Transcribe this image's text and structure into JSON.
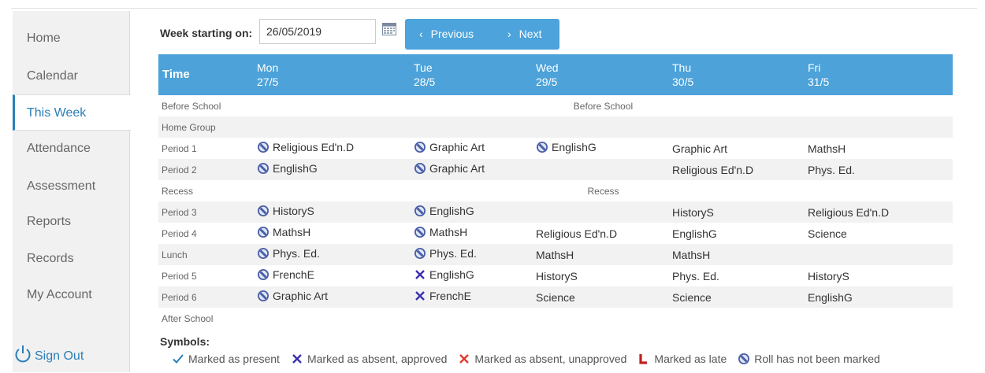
{
  "sidebar": {
    "items": [
      {
        "label": "Home",
        "active": false
      },
      {
        "label": "Calendar",
        "active": false
      },
      {
        "label": "This Week",
        "active": true
      },
      {
        "label": "Attendance",
        "active": false
      },
      {
        "label": "Assessment",
        "active": false
      },
      {
        "label": "Reports",
        "active": false
      },
      {
        "label": "Records",
        "active": false
      },
      {
        "label": "My Account",
        "active": false
      }
    ],
    "sign_out": "Sign Out"
  },
  "toolbar": {
    "week_label": "Week starting on:",
    "week_value": "26/05/2019",
    "previous_label": "Previous",
    "next_label": "Next"
  },
  "timetable": {
    "time_header": "Time",
    "days": [
      {
        "name": "Mon",
        "date": "27/5"
      },
      {
        "name": "Tue",
        "date": "28/5"
      },
      {
        "name": "Wed",
        "date": "29/5"
      },
      {
        "name": "Thu",
        "date": "30/5"
      },
      {
        "name": "Fri",
        "date": "31/5"
      }
    ],
    "rows": [
      {
        "period": "Before School",
        "span": "Before School"
      },
      {
        "period": "Home Group",
        "span": ""
      },
      {
        "period": "Period 1",
        "cells": [
          {
            "text": "Religious Ed'n.D",
            "sym": "roll-not-marked"
          },
          {
            "text": "Graphic Art",
            "sym": "roll-not-marked"
          },
          {
            "text": "EnglishG",
            "sym": "roll-not-marked"
          },
          {
            "text": "Graphic Art",
            "sym": ""
          },
          {
            "text": "MathsH",
            "sym": ""
          }
        ]
      },
      {
        "period": "Period 2",
        "cells": [
          {
            "text": "EnglishG",
            "sym": "roll-not-marked"
          },
          {
            "text": "Graphic Art",
            "sym": "roll-not-marked"
          },
          {
            "text": "",
            "sym": ""
          },
          {
            "text": "Religious Ed'n.D",
            "sym": ""
          },
          {
            "text": "Phys. Ed.",
            "sym": ""
          }
        ]
      },
      {
        "period": "Recess",
        "span": "Recess"
      },
      {
        "period": "Period 3",
        "cells": [
          {
            "text": "HistoryS",
            "sym": "roll-not-marked"
          },
          {
            "text": "EnglishG",
            "sym": "roll-not-marked"
          },
          {
            "text": "",
            "sym": ""
          },
          {
            "text": "HistoryS",
            "sym": ""
          },
          {
            "text": "Religious Ed'n.D",
            "sym": ""
          }
        ]
      },
      {
        "period": "Period 4",
        "cells": [
          {
            "text": "MathsH",
            "sym": "roll-not-marked"
          },
          {
            "text": "MathsH",
            "sym": "roll-not-marked"
          },
          {
            "text": "Religious Ed'n.D",
            "sym": ""
          },
          {
            "text": "EnglishG",
            "sym": ""
          },
          {
            "text": "Science",
            "sym": ""
          }
        ]
      },
      {
        "period": "Lunch",
        "cells": [
          {
            "text": "Phys. Ed.",
            "sym": "roll-not-marked"
          },
          {
            "text": "Phys. Ed.",
            "sym": "roll-not-marked"
          },
          {
            "text": "MathsH",
            "sym": ""
          },
          {
            "text": "MathsH",
            "sym": ""
          },
          {
            "text": "",
            "sym": ""
          }
        ]
      },
      {
        "period": "Period 5",
        "cells": [
          {
            "text": "FrenchE",
            "sym": "roll-not-marked"
          },
          {
            "text": "EnglishG",
            "sym": "absent-approved"
          },
          {
            "text": "HistoryS",
            "sym": ""
          },
          {
            "text": "Phys. Ed.",
            "sym": ""
          },
          {
            "text": "HistoryS",
            "sym": ""
          }
        ]
      },
      {
        "period": "Period 6",
        "cells": [
          {
            "text": "Graphic Art",
            "sym": "roll-not-marked"
          },
          {
            "text": "FrenchE",
            "sym": "absent-approved"
          },
          {
            "text": "Science",
            "sym": ""
          },
          {
            "text": "Science",
            "sym": ""
          },
          {
            "text": "EnglishG",
            "sym": ""
          }
        ]
      },
      {
        "period": "After School",
        "span": ""
      }
    ]
  },
  "symbols": {
    "title": "Symbols:",
    "items": [
      {
        "icon": "present",
        "label": "Marked as present"
      },
      {
        "icon": "absent-approved",
        "label": "Marked as absent, approved"
      },
      {
        "icon": "absent-unapproved",
        "label": "Marked as absent, unapproved"
      },
      {
        "icon": "late",
        "label": "Marked as late"
      },
      {
        "icon": "roll-not-marked",
        "label": "Roll has not been marked"
      }
    ]
  },
  "colors": {
    "accent": "#4ca2d9",
    "present": "#2a7fb8",
    "absent_approved": "#3a2fb0",
    "absent_unapproved": "#e03a2a",
    "late": "#c02020",
    "roll_not_marked": "#4a5fa8"
  }
}
